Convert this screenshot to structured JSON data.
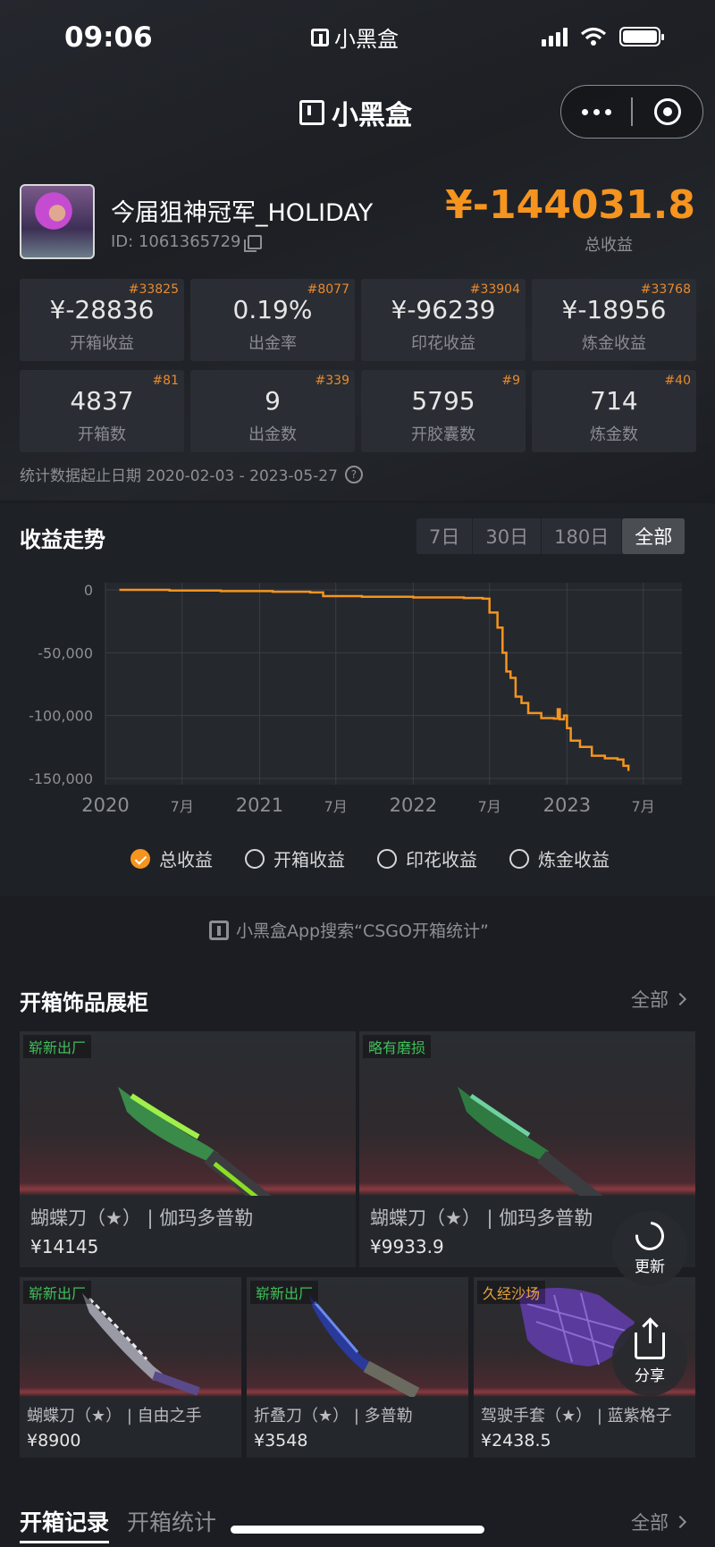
{
  "status_bar": {
    "time": "09:06",
    "app_name": "小黑盒"
  },
  "nav": {
    "title": "小黑盒"
  },
  "profile": {
    "username": "今届狙神冠军_HOLIDAY",
    "id_text": "ID: 1061365729",
    "total_value": "¥-144031.8",
    "total_label": "总收益"
  },
  "stats": [
    {
      "value": "¥-28836",
      "label": "开箱收益",
      "rank": "#33825"
    },
    {
      "value": "0.19%",
      "label": "出金率",
      "rank": "#8077"
    },
    {
      "value": "¥-96239",
      "label": "印花收益",
      "rank": "#33904"
    },
    {
      "value": "¥-18956",
      "label": "炼金收益",
      "rank": "#33768"
    },
    {
      "value": "4837",
      "label": "开箱数",
      "rank": "#81"
    },
    {
      "value": "9",
      "label": "出金数",
      "rank": "#339"
    },
    {
      "value": "5795",
      "label": "开胶囊数",
      "rank": "#9"
    },
    {
      "value": "714",
      "label": "炼金数",
      "rank": "#40"
    }
  ],
  "date_range": "统计数据起止日期 2020-02-03 - 2023-05-27",
  "trend": {
    "title": "收益走势",
    "tabs": [
      "7日",
      "30日",
      "180日",
      "全部"
    ],
    "active_tab": "全部",
    "legend": [
      "总收益",
      "开箱收益",
      "印花收益",
      "炼金收益"
    ],
    "legend_checked": "总收益",
    "line_color": "#f5941e"
  },
  "chart_data": {
    "type": "line",
    "x_ticks": [
      "2020",
      "7月",
      "2021",
      "7月",
      "2022",
      "7月",
      "2023",
      "7月"
    ],
    "y_ticks": [
      "0",
      "-50,000",
      "-100,000",
      "-150,000"
    ],
    "ylim": [
      -155000,
      0
    ],
    "series": [
      {
        "x": [
          "2020-02-03",
          "2020-06-01",
          "2020-10-01",
          "2021-02-01",
          "2021-05-01",
          "2021-06-01",
          "2021-09-01",
          "2022-01-01",
          "2022-05-01",
          "2022-06-15",
          "2022-07-01",
          "2022-07-20",
          "2022-08-01",
          "2022-08-10",
          "2022-08-20",
          "2022-09-01",
          "2022-09-15",
          "2022-10-01",
          "2022-11-01",
          "2022-12-01",
          "2022-12-10",
          "2022-12-15",
          "2022-12-25",
          "2023-01-01",
          "2023-01-10",
          "2023-02-01",
          "2023-03-01",
          "2023-04-01",
          "2023-05-01",
          "2023-05-15",
          "2023-05-27"
        ],
        "y": [
          0,
          -500,
          -1000,
          -1500,
          -2000,
          -5000,
          -5500,
          -6000,
          -6500,
          -7000,
          -18000,
          -30000,
          -50000,
          -65000,
          -70000,
          -85000,
          -90000,
          -98000,
          -102000,
          -102500,
          -95000,
          -103000,
          -100000,
          -110000,
          -120000,
          -125000,
          -132000,
          -134000,
          -135000,
          -140000,
          -144031.8
        ]
      }
    ]
  },
  "promo_text": "小黑盒App搜索“CSGO开箱统计”",
  "showcase": {
    "title": "开箱饰品展柜",
    "more": "全部",
    "items": [
      {
        "wear": "崭新出厂",
        "wear_color": "#3fbf5a",
        "name": "蝴蝶刀（★） | 伽玛多普勒",
        "price": "¥14145",
        "art": "green"
      },
      {
        "wear": "略有磨损",
        "wear_color": "#3fbf5a",
        "name": "蝴蝶刀（★） | 伽玛多普勒",
        "price": "¥9933.9",
        "art": "green"
      },
      {
        "wear": "崭新出厂",
        "wear_color": "#3fbf5a",
        "name": "蝴蝶刀（★） | 自由之手",
        "price": "¥8900",
        "art": "white"
      },
      {
        "wear": "崭新出厂",
        "wear_color": "#3fbf5a",
        "name": "折叠刀（★） | 多普勒",
        "price": "¥3548",
        "art": "blue"
      },
      {
        "wear": "久经沙场",
        "wear_color": "#e8a33a",
        "name": "驾驶手套（★） | 蓝紫格子",
        "price": "¥2438.5",
        "art": "glove"
      }
    ]
  },
  "float_buttons": {
    "refresh": "更新",
    "share": "分享"
  },
  "bottom_tabs": {
    "tabs": [
      "开箱记录",
      "开箱统计"
    ],
    "more": "全部"
  }
}
